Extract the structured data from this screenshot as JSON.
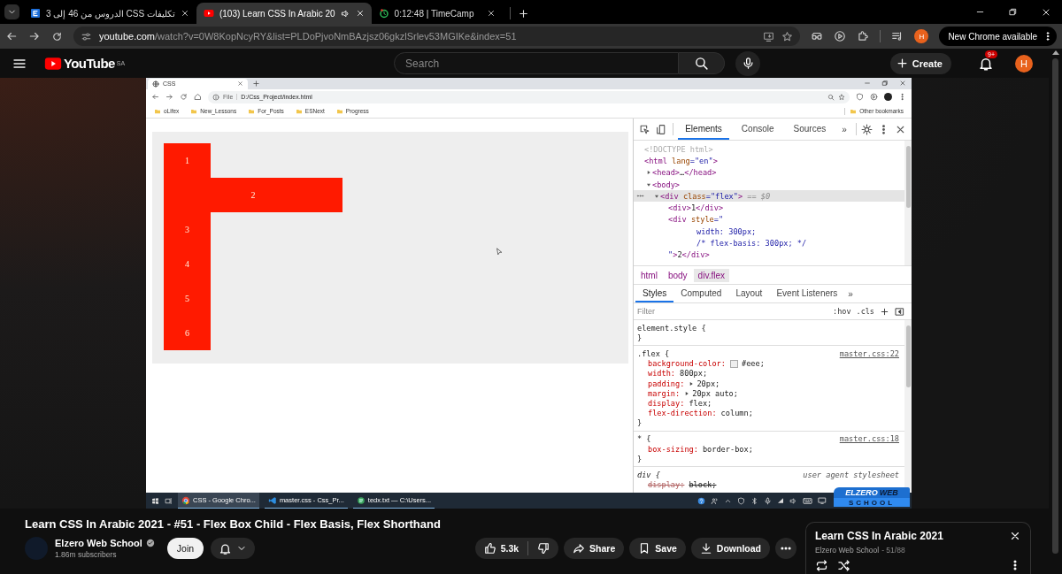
{
  "browser": {
    "tabs": [
      {
        "title": "تكليفات CSS الدروس من 46 إلى 3",
        "kind": "site",
        "audio": false,
        "selected": false
      },
      {
        "title": "(103) Learn CSS In Arabic 20",
        "kind": "youtube",
        "audio": true,
        "selected": true
      },
      {
        "title": "0:12:48 | TimeCamp",
        "kind": "timer",
        "audio": false,
        "selected": false
      }
    ],
    "address": {
      "host": "youtube.com",
      "path": "/watch?v=0W8KopNcyRY&list=PLDoPjvoNmBAzjsz06gkzlSrlev53MGIKe&index=51"
    },
    "profile": "H",
    "update_button": "New Chrome available"
  },
  "header": {
    "logo": "YouTube",
    "region": "SA",
    "search": {
      "placeholder": "Search"
    },
    "create": "Create",
    "notifications": "9+",
    "avatar": "H"
  },
  "video": {
    "inner_browser": {
      "tab": "CSS",
      "security": "File",
      "address": "D:/Css_Project/index.html",
      "bookmarks": [
        "oLifex",
        "New_Lessons",
        "For_Posts",
        "ESNext",
        "Progress"
      ],
      "other_bookmarks": "Other bookmarks"
    },
    "page": {
      "items": [
        {
          "label": "1",
          "wide": false
        },
        {
          "label": "2",
          "wide": true
        },
        {
          "label": "3",
          "wide": false
        },
        {
          "label": "4",
          "wide": false
        },
        {
          "label": "5",
          "wide": false
        },
        {
          "label": "6",
          "wide": false
        }
      ]
    },
    "devtools": {
      "tabs": [
        {
          "label": "Elements",
          "selected": true
        },
        {
          "label": "Console",
          "selected": false
        },
        {
          "label": "Sources",
          "selected": false
        }
      ],
      "more_tabs": "»",
      "dom": [
        {
          "selected": false,
          "lines": [
            [
              {
                "kind": "doctype",
                "text": "<!DOCTYPE html>"
              }
            ]
          ]
        },
        {
          "selected": false,
          "lines": [
            [
              {
                "kind": "tag",
                "text": "<html "
              },
              {
                "kind": "attr",
                "text": "lang"
              },
              {
                "kind": "value",
                "text": "=\"en\""
              },
              {
                "kind": "tag",
                "text": ">"
              }
            ]
          ],
          "children": [
            {
              "selected": false,
              "expanded": false,
              "lines": [
                [
                  {
                    "kind": "tag",
                    "text": "<head>"
                  },
                  {
                    "kind": "text",
                    "text": "…"
                  },
                  {
                    "kind": "tag",
                    "text": "</head>"
                  }
                ]
              ]
            },
            {
              "selected": false,
              "expanded": true,
              "lines": [
                [
                  {
                    "kind": "tag",
                    "text": "<body>"
                  }
                ]
              ],
              "children": [
                {
                  "selected": true,
                  "expanded": true,
                  "lines": [
                    [
                      {
                        "kind": "tag",
                        "text": "<div "
                      },
                      {
                        "kind": "attr",
                        "text": "class"
                      },
                      {
                        "kind": "value",
                        "text": "=\"flex\""
                      },
                      {
                        "kind": "tag",
                        "text": ">"
                      },
                      {
                        "kind": "marker",
                        "text": " == $0"
                      }
                    ]
                  ],
                  "children": [
                    {
                      "selected": false,
                      "lines": [
                        [
                          {
                            "kind": "tag",
                            "text": "<div>"
                          },
                          {
                            "kind": "text",
                            "text": "1"
                          },
                          {
                            "kind": "tag",
                            "text": "</div>"
                          }
                        ]
                      ]
                    },
                    {
                      "selected": false,
                      "lines": [
                        [
                          {
                            "kind": "tag",
                            "text": "<div "
                          },
                          {
                            "kind": "attr",
                            "text": "style"
                          },
                          {
                            "kind": "value",
                            "text": "=\""
                          }
                        ],
                        [
                          {
                            "kind": "value",
                            "text": "width: 300px;"
                          }
                        ],
                        [
                          {
                            "kind": "value",
                            "text": "/* flex-basis: 300px; */"
                          }
                        ],
                        [
                          {
                            "kind": "value",
                            "text": "\""
                          },
                          {
                            "kind": "tag",
                            "text": ">"
                          },
                          {
                            "kind": "text",
                            "text": "2"
                          },
                          {
                            "kind": "tag",
                            "text": "</div>"
                          }
                        ]
                      ]
                    }
                  ]
                }
              ]
            }
          ]
        }
      ],
      "breadcrumbs": [
        {
          "label": "html",
          "selected": false
        },
        {
          "label": "body",
          "selected": false
        },
        {
          "label": "div.flex",
          "selected": true
        }
      ],
      "style_tabs": [
        {
          "label": "Styles",
          "selected": true
        },
        {
          "label": "Computed",
          "selected": false
        },
        {
          "label": "Layout",
          "selected": false
        },
        {
          "label": "Event Listeners",
          "selected": false
        }
      ],
      "more_style_tabs": "»",
      "filter": {
        "placeholder": "Filter"
      },
      "hov": ":hov",
      "cls": ".cls",
      "rules": [
        {
          "selector": "element.style {",
          "user_agent": false,
          "close": "}"
        },
        {
          "selector": ".flex {",
          "source": "master.css:22",
          "user_agent": false,
          "close": "}",
          "declarations": [
            {
              "property": "background-color:",
              "value": "#eee;",
              "color": "#eeeeee",
              "expandable": false,
              "struck": false
            },
            {
              "property": "width:",
              "value": "800px;",
              "expandable": false,
              "struck": false
            },
            {
              "property": "padding:",
              "value": "20px;",
              "expandable": true,
              "struck": false
            },
            {
              "property": "margin:",
              "value": "20px auto;",
              "expandable": true,
              "struck": false
            },
            {
              "property": "display:",
              "value": "flex;",
              "expandable": false,
              "struck": false
            },
            {
              "property": "flex-direction:",
              "value": "column;",
              "expandable": false,
              "struck": false
            }
          ]
        },
        {
          "selector": "* {",
          "source": "master.css:18",
          "user_agent": false,
          "close": "}",
          "declarations": [
            {
              "property": "box-sizing:",
              "value": "border-box;",
              "expandable": false,
              "struck": false
            }
          ]
        },
        {
          "selector": "div {",
          "source": "user agent stylesheet",
          "user_agent": true,
          "declarations": [
            {
              "property": "display:",
              "value": "block;",
              "expandable": false,
              "struck": true
            }
          ]
        }
      ]
    },
    "taskbar": {
      "apps": [
        {
          "kind": "chrome",
          "label": "CSS - Google Chro...",
          "selected": true
        },
        {
          "kind": "vscode",
          "label": "master.css - Css_Pr...",
          "selected": false
        },
        {
          "kind": "notepad",
          "label": "tedx.txt — C:\\Users...",
          "selected": false
        }
      ]
    },
    "overlay_logo": {
      "first": "ELZERO",
      "second": "WEB",
      "third": "SCHOOL"
    }
  },
  "details": {
    "title": "Learn CSS In Arabic 2021 - #51 - Flex Box Child - Flex Basis, Flex Shorthand",
    "channel": "Elzero Web School",
    "verified": true,
    "subscribers": "1.86m subscribers",
    "join": "Join",
    "likes": "5.3k",
    "actions": [
      {
        "kind": "share",
        "label": "Share"
      },
      {
        "kind": "save",
        "label": "Save"
      },
      {
        "kind": "download",
        "label": "Download"
      }
    ]
  },
  "playlist": {
    "title": "Learn CSS In Arabic 2021",
    "channel": "Elzero Web School",
    "position": "- 51/88"
  }
}
